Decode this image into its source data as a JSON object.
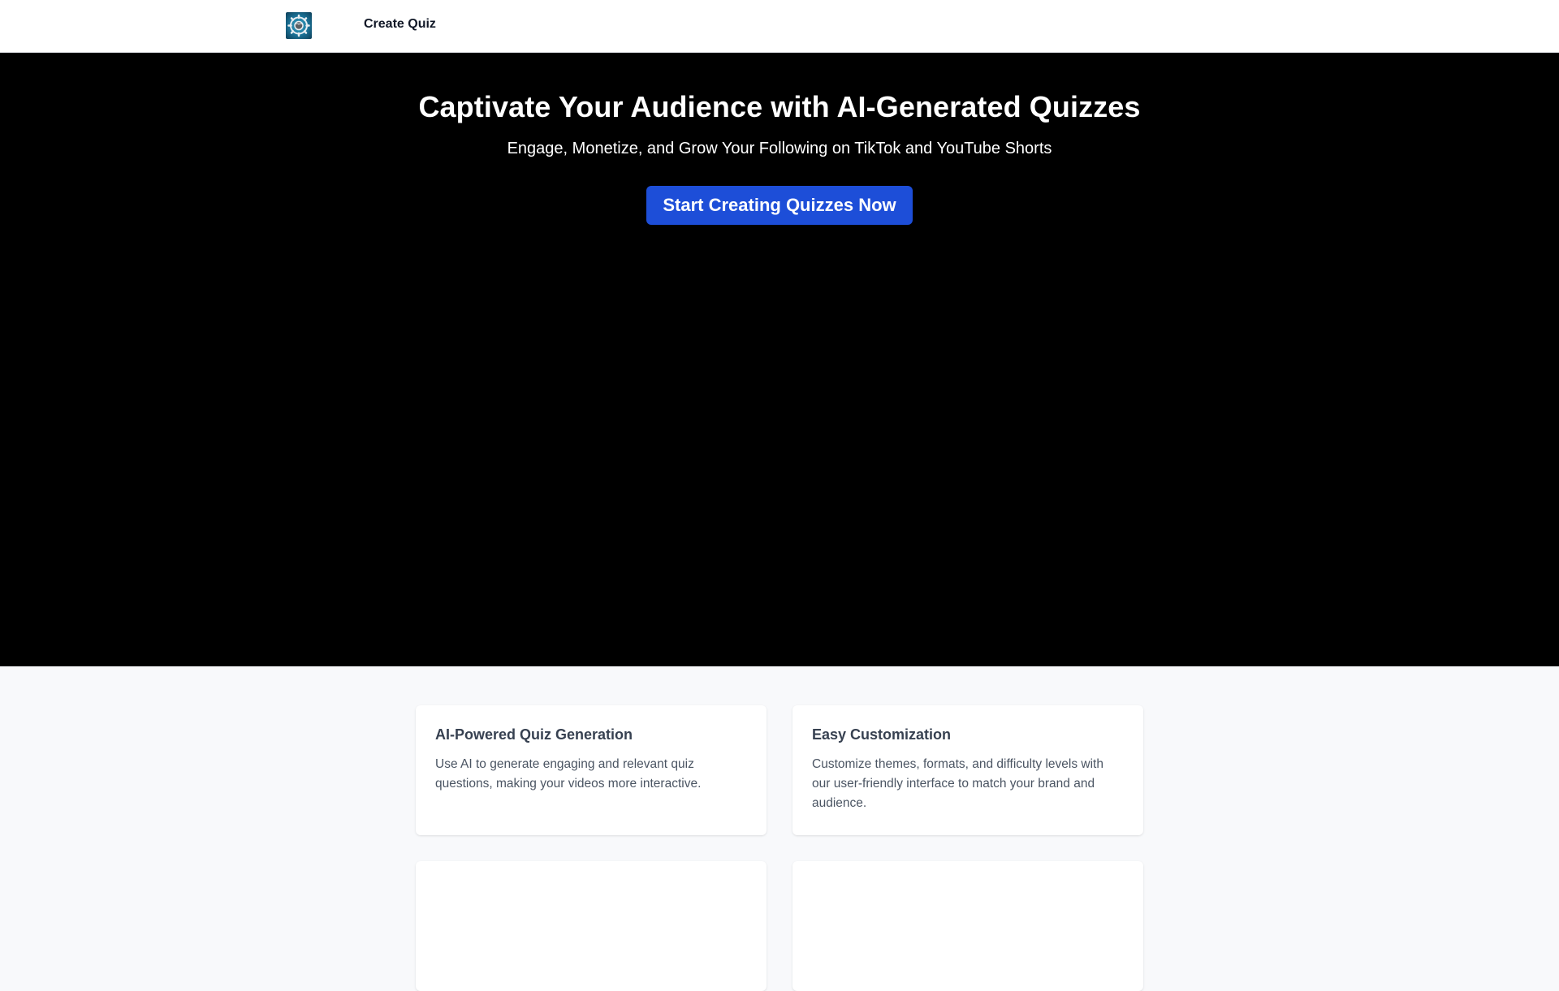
{
  "nav": {
    "logo_icon": "brain-gear-logo-icon",
    "create_quiz_label": "Create Quiz"
  },
  "hero": {
    "title": "Captivate Your Audience with AI-Generated Quizzes",
    "subtitle": "Engage, Monetize, and Grow Your Following on TikTok and YouTube Shorts",
    "cta_label": "Start Creating Quizzes Now"
  },
  "features": [
    {
      "title": "AI-Powered Quiz Generation",
      "description": "Use AI to generate engaging and relevant quiz questions, making your videos more interactive."
    },
    {
      "title": "Easy Customization",
      "description": "Customize themes, formats, and difficulty levels with our user-friendly interface to match your brand and audience."
    }
  ],
  "colors": {
    "nav_background": "#ffffff",
    "hero_background": "#000000",
    "cta_background": "#1d4ed8",
    "features_background": "#f8f9fb",
    "card_background": "#ffffff"
  }
}
